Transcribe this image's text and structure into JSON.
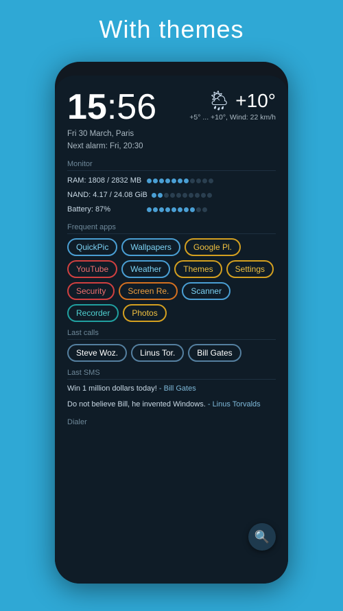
{
  "header": {
    "title": "With themes"
  },
  "phone": {
    "time": {
      "hours": "15",
      "separator": ":",
      "minutes": "56"
    },
    "date": "Fri 30 March, Paris",
    "alarm": "Next alarm: Fri, 20:30",
    "weather": {
      "icon": "🌦",
      "temp": "+10°",
      "detail": "+5° ... +10°, Wind: 22 km/h"
    },
    "sections": {
      "monitor": "Monitor",
      "frequent_apps": "Frequent apps",
      "last_calls": "Last calls",
      "last_sms": "Last SMS",
      "dialer": "Dialer"
    },
    "monitor": [
      {
        "label": "RAM: 1808 / 2832 MB",
        "filled": 7,
        "empty": 4
      },
      {
        "label": "NAND: 4.17 / 24.08 GiB",
        "filled": 2,
        "empty": 8
      },
      {
        "label": "Battery: 87%",
        "filled": 8,
        "empty": 2
      }
    ],
    "apps": [
      {
        "label": "QuickPic",
        "color": "chip-blue"
      },
      {
        "label": "Wallpapers",
        "color": "chip-blue"
      },
      {
        "label": "Google Pl.",
        "color": "chip-yellow"
      },
      {
        "label": "YouTube",
        "color": "chip-red"
      },
      {
        "label": "Weather",
        "color": "chip-blue"
      },
      {
        "label": "Themes",
        "color": "chip-yellow"
      },
      {
        "label": "Settings",
        "color": "chip-yellow"
      },
      {
        "label": "Security",
        "color": "chip-red"
      },
      {
        "label": "Screen Re.",
        "color": "chip-orange"
      },
      {
        "label": "Scanner",
        "color": "chip-blue"
      },
      {
        "label": "Recorder",
        "color": "chip-teal"
      },
      {
        "label": "Photos",
        "color": "chip-yellow"
      }
    ],
    "calls": [
      {
        "label": "Steve Woz."
      },
      {
        "label": "Linus Tor."
      },
      {
        "label": "Bill Gates"
      }
    ],
    "sms": [
      {
        "text": "Win 1 million dollars today!",
        "sender": "- Bill Gates"
      },
      {
        "text": "Do not believe Bill, he invented Windows.",
        "sender": "- Linus Torvalds"
      }
    ],
    "fab": {
      "icon": "🔍"
    }
  }
}
